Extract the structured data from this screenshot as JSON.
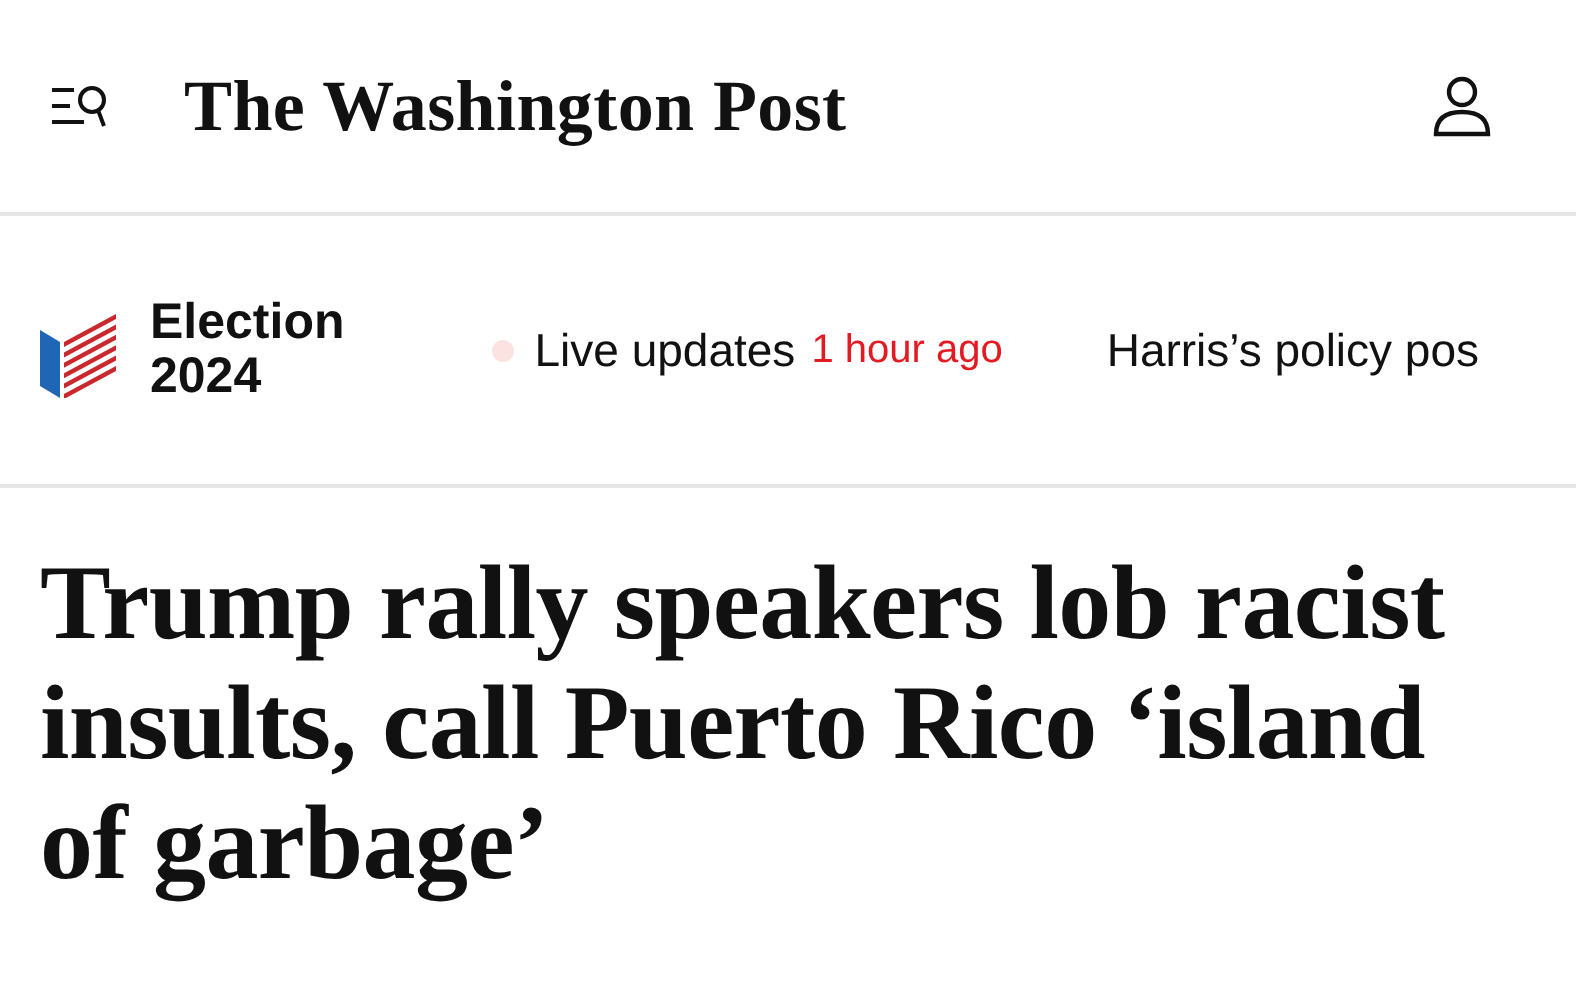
{
  "header": {
    "logo": "The Washington Post"
  },
  "election_bar": {
    "label_lines": [
      "Election",
      "2024"
    ],
    "items": [
      {
        "kind": "live",
        "label": "Live updates",
        "time": "1 hour ago"
      },
      {
        "kind": "link",
        "label": "Harris’s policy pos"
      }
    ]
  },
  "article": {
    "headline": "Trump rally speakers lob racist insults, call Puerto Rico ‘island of garbage’"
  }
}
